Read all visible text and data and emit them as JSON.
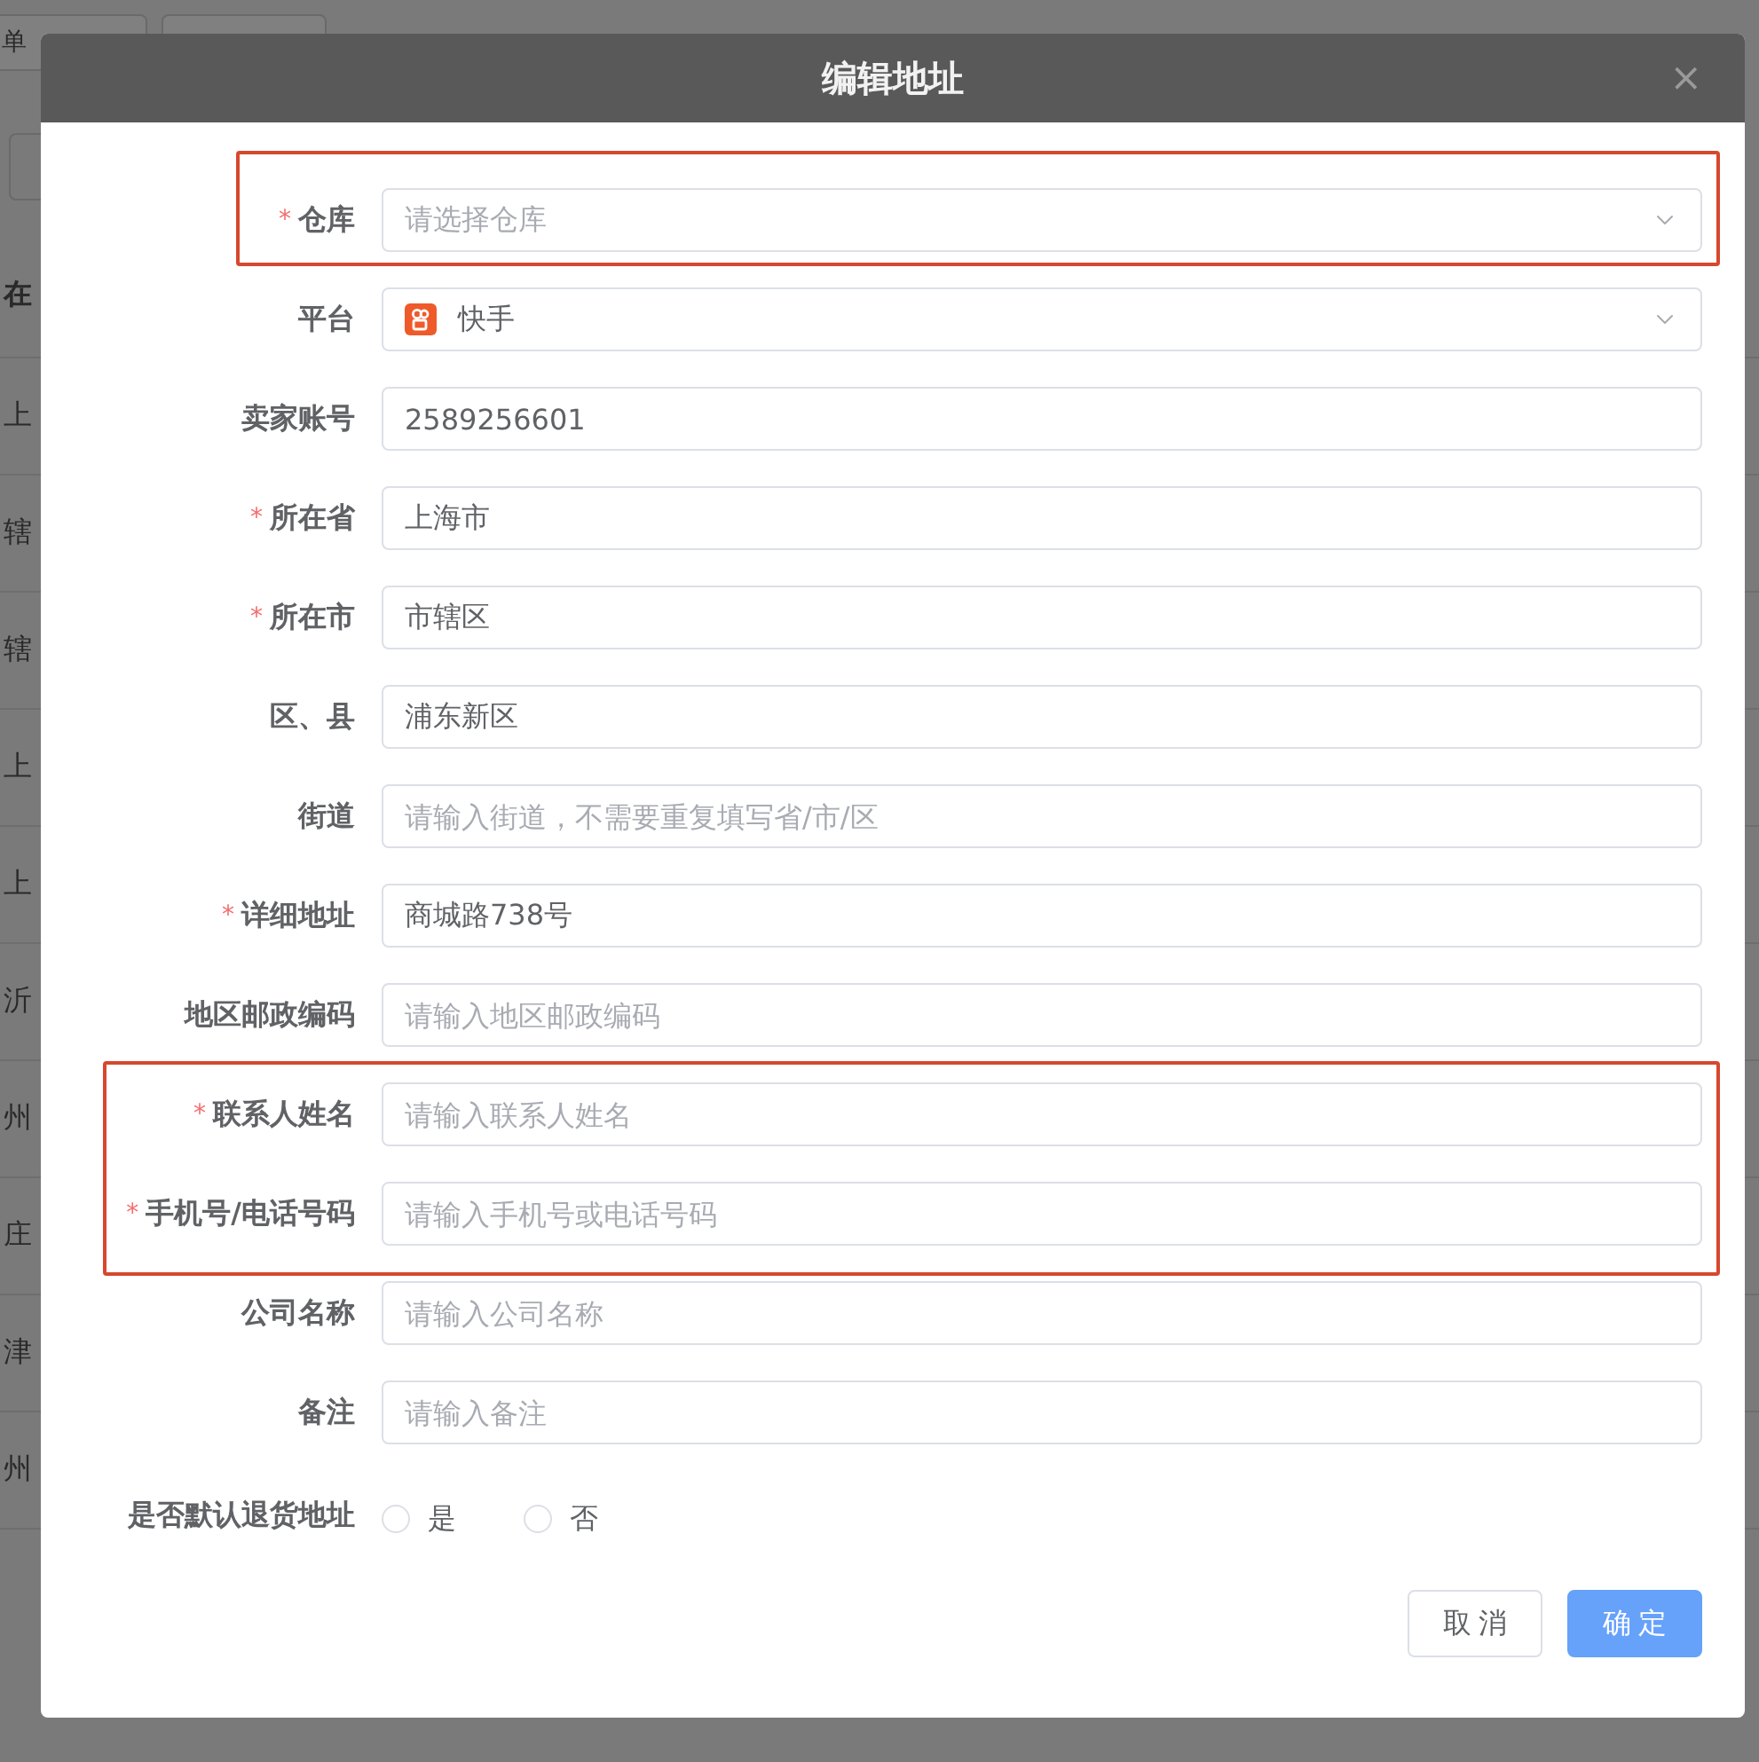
{
  "background": {
    "tabs": [
      "单"
    ],
    "table_header": "在",
    "table_cells": [
      "上",
      "辖",
      "辖",
      "上",
      "上",
      "沂",
      "州",
      "庄",
      "津",
      "州"
    ]
  },
  "dialog": {
    "title": "编辑地址",
    "close": "×",
    "fields": [
      {
        "kind": "select",
        "required_mark": "*",
        "label": "仓库",
        "placeholder": "请选择仓库",
        "highlighted": true
      },
      {
        "kind": "select",
        "label": "平台",
        "value": "快手",
        "platform_icon": true
      },
      {
        "kind": "input",
        "label": "卖家账号",
        "value": "2589256601"
      },
      {
        "kind": "input",
        "required_mark": "*",
        "label": "所在省",
        "value": "上海市"
      },
      {
        "kind": "input",
        "required_mark": "*",
        "label": "所在市",
        "value": "市辖区"
      },
      {
        "kind": "input",
        "label": "区、县",
        "value": "浦东新区"
      },
      {
        "kind": "input",
        "label": "街道",
        "placeholder": "请输入街道，不需要重复填写省/市/区"
      },
      {
        "kind": "input",
        "required_mark": "*",
        "label": "详细地址",
        "value": "商城路738号"
      },
      {
        "kind": "input",
        "label": "地区邮政编码",
        "placeholder": "请输入地区邮政编码"
      },
      {
        "kind": "input",
        "required_mark": "*",
        "label": "联系人姓名",
        "placeholder": "请输入联系人姓名",
        "highlighted": true
      },
      {
        "kind": "input",
        "required_mark": "*",
        "label": "手机号/电话号码",
        "placeholder": "请输入手机号或电话号码",
        "highlighted": true
      },
      {
        "kind": "input",
        "label": "公司名称",
        "placeholder": "请输入公司名称"
      },
      {
        "kind": "input",
        "label": "备注",
        "placeholder": "请输入备注"
      },
      {
        "kind": "radio",
        "label": "是否默认退货地址",
        "options": [
          {
            "label": "是",
            "selected": false
          },
          {
            "label": "否",
            "selected": false
          }
        ]
      }
    ],
    "buttons": [
      {
        "label": "取消",
        "kind": "secondary"
      },
      {
        "label": "确定",
        "kind": "primary"
      }
    ]
  }
}
